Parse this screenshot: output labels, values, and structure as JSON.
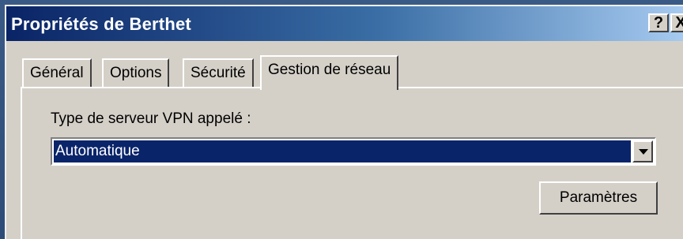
{
  "window": {
    "title": "Propriétés de Berthet",
    "help_label": "?",
    "close_label": "X"
  },
  "tabs": [
    {
      "label": "Général",
      "active": false
    },
    {
      "label": "Options",
      "active": false
    },
    {
      "label": "Sécurité",
      "active": false
    },
    {
      "label": "Gestion de réseau",
      "active": true
    }
  ],
  "network": {
    "vpn_type_label": "Type de serveur VPN appelé :",
    "vpn_type_value": "Automatique",
    "settings_button": "Paramètres"
  },
  "colors": {
    "titlebar_start": "#0a2466",
    "selection": "#0a246a",
    "face": "#d4d0c8"
  }
}
